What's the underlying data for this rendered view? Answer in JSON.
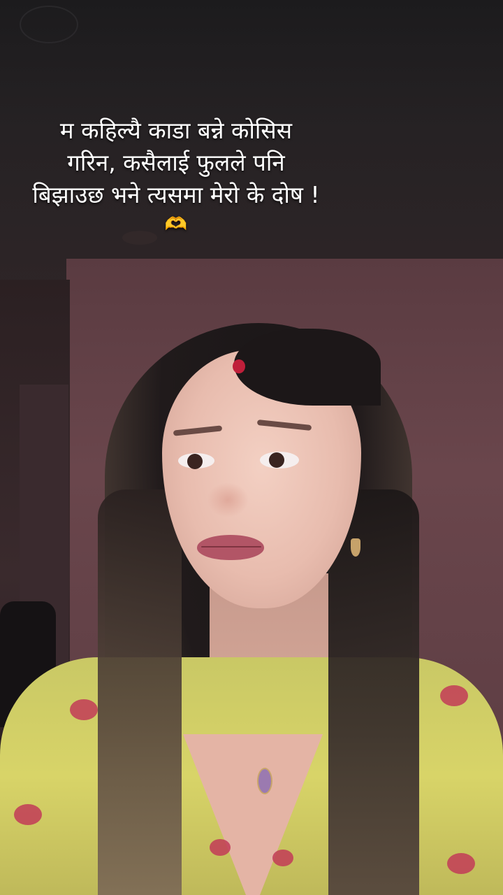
{
  "caption": {
    "line1": "म कहिल्यै काडा बन्ने कोसिस",
    "line2": "गरिन, कसैलाई फुलले पनि",
    "line3": "बिझाउछ भने त्यसमा मेरो के दोष !",
    "emoji": "🫶"
  },
  "scene": {
    "subject": "woman-portrait",
    "colors": {
      "wall": "#6a464c",
      "ceiling": "#262224",
      "dress": "#d8d468",
      "accent_red": "#c01f3a"
    }
  }
}
